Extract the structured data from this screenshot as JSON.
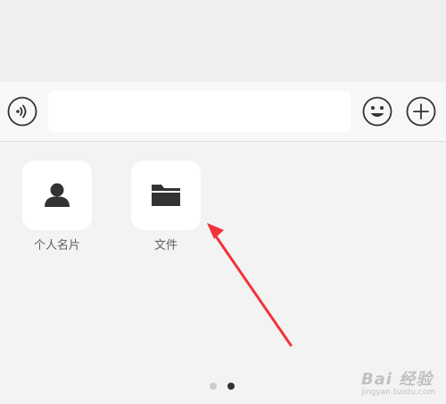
{
  "composer": {
    "input_value": "",
    "voice_icon": "voice-wave-icon",
    "emoji_icon": "smiley-icon",
    "plus_icon": "plus-circle-icon"
  },
  "panel": {
    "items": [
      {
        "label": "个人名片",
        "icon": "person-icon"
      },
      {
        "label": "文件",
        "icon": "folder-icon"
      }
    ],
    "page_count": 2,
    "current_page": 2
  },
  "colors": {
    "arrow": "#f0333a",
    "dot_active": "#333333",
    "dot_inactive": "#cccccc",
    "icon_dark": "#333333"
  },
  "watermark": {
    "brand": "Bai 经验",
    "sub": "jingyan.baidu.com"
  }
}
